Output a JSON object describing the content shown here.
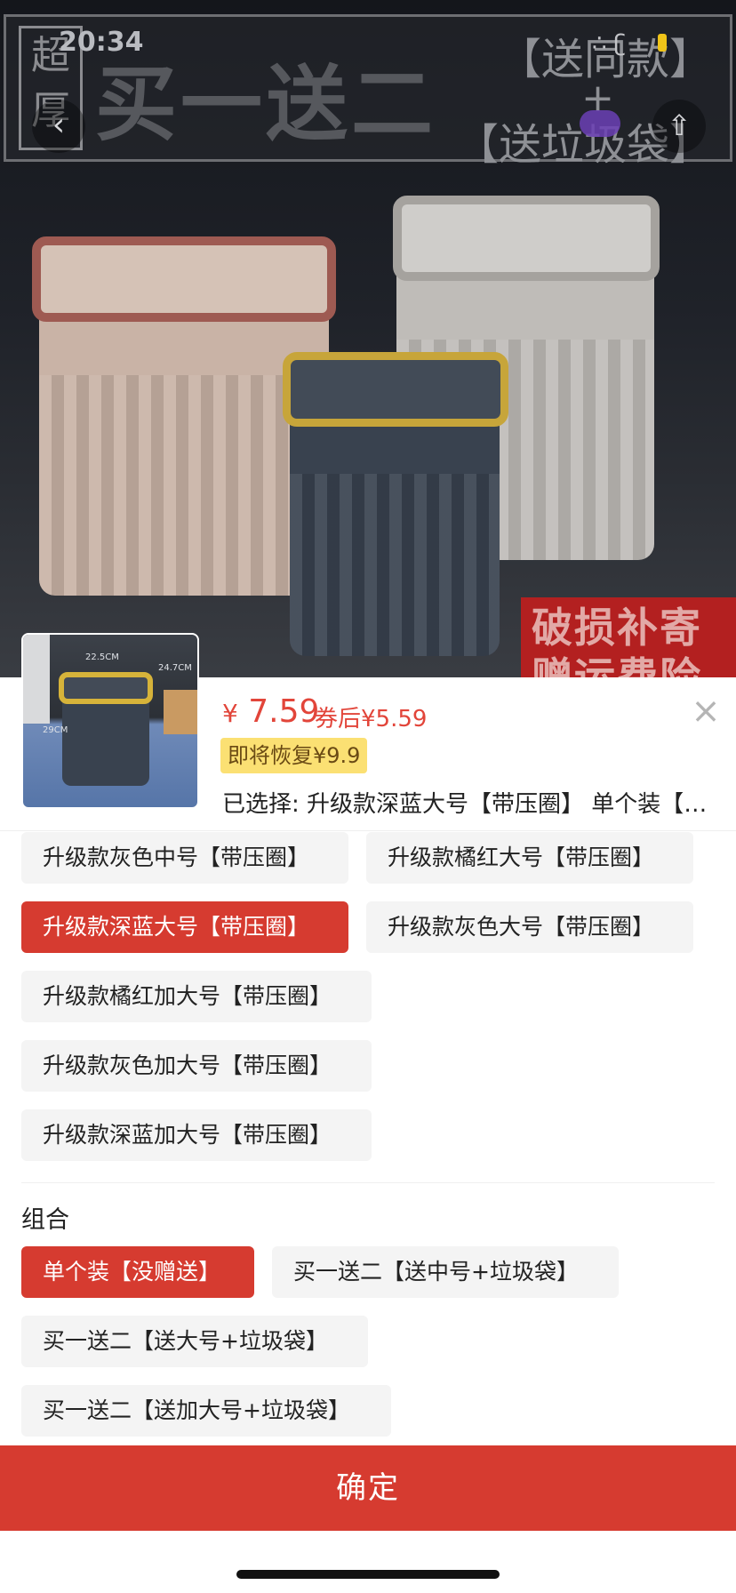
{
  "status_bar": {
    "time": "20:34",
    "signal": "∴ ʗ"
  },
  "banner": {
    "tag": "超厚",
    "title": "买一送二",
    "right_line1": "【送同款】",
    "plus": "+",
    "right_line2": "【送垃圾袋】"
  },
  "photo_badge": "破损补寄赠运费险",
  "header_icons": {
    "back": "back-arrow-icon",
    "share": "share-icon"
  },
  "product": {
    "price_symbol": "¥",
    "price": "7.59",
    "coupon_price": "券后¥5.59",
    "restore_badge": "即将恢复¥9.9",
    "selected": "已选择: 升级款深蓝大号【带压圈】 单个装【没赠送】",
    "close": "×",
    "thumb_dims": [
      "22.5CM",
      "24.7CM",
      "29CM"
    ]
  },
  "styles": [
    {
      "label": "升级款灰色中号【带压圈】",
      "selected": false
    },
    {
      "label": "升级款橘红大号【带压圈】",
      "selected": false
    },
    {
      "label": "升级款深蓝大号【带压圈】",
      "selected": true
    },
    {
      "label": "升级款灰色大号【带压圈】",
      "selected": false
    },
    {
      "label": "升级款橘红加大号【带压圈】",
      "selected": false
    },
    {
      "label": "升级款灰色加大号【带压圈】",
      "selected": false
    },
    {
      "label": "升级款深蓝加大号【带压圈】",
      "selected": false
    }
  ],
  "combo": {
    "heading": "组合",
    "options": [
      {
        "label": "单个装【没赠送】",
        "selected": true
      },
      {
        "label": "买一送二【送中号+垃圾袋】",
        "selected": false
      },
      {
        "label": "买一送二【送大号+垃圾袋】",
        "selected": false
      },
      {
        "label": "买一送二【送加大号+垃圾袋】",
        "selected": false
      }
    ]
  },
  "confirm_label": "确定",
  "colors": {
    "accent": "#d63b30",
    "price": "#e2453a",
    "badge": "#fbe073",
    "chip_bg": "#f4f4f4"
  }
}
